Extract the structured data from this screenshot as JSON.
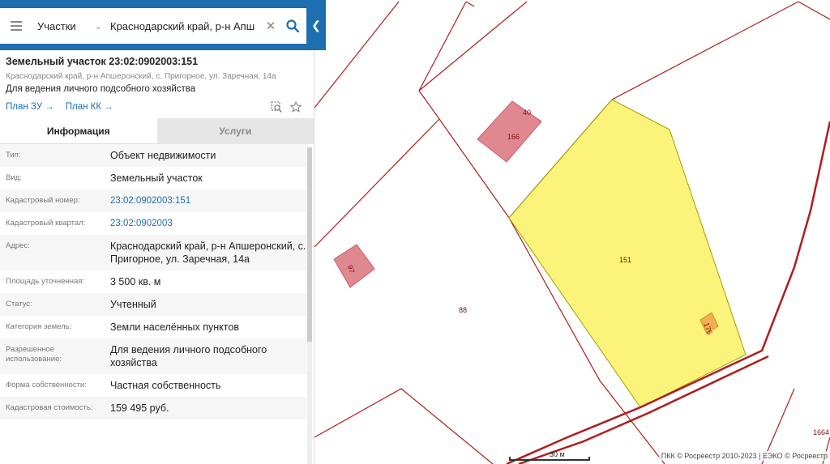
{
  "search": {
    "layer": "Участки",
    "query": "Краснодарский край, р-н Апш"
  },
  "parcel": {
    "title": "Земельный участок 23:02:0902003:151",
    "address_short": "Краснодарский край, р-н Апшеронский, с. Пригорное, ул. Заречная, 14а",
    "purpose": "Для ведения личного подсобного хозяйства",
    "links": [
      "План ЗУ →",
      "План КК →"
    ]
  },
  "tabs": [
    "Информация",
    "Услуги"
  ],
  "info_rows": [
    {
      "label": "Тип:",
      "value": "Объект недвижимости",
      "link": false
    },
    {
      "label": "Вид:",
      "value": "Земельный участок",
      "link": false
    },
    {
      "label": "Кадастровый номер:",
      "value": "23:02:0902003:151",
      "link": true
    },
    {
      "label": "Кадастровый квартал:",
      "value": "23:02:0902003",
      "link": true
    },
    {
      "label": "Адрес:",
      "value": "Краснодарский край, р-н Апшеронский, с. Пригорное, ул. Заречная, 14а",
      "link": false
    },
    {
      "label": "Площадь уточненная:",
      "value": "3 500 кв. м",
      "link": false
    },
    {
      "label": "Статус:",
      "value": "Учтенный",
      "link": false
    },
    {
      "label": "Категория земель:",
      "value": "Земли населённых пунктов",
      "link": false
    },
    {
      "label": "Разрешенное использование:",
      "value": "Для ведения личного подсобного хозяйства",
      "link": false
    },
    {
      "label": "Форма собственности:",
      "value": "Частная собственность",
      "link": false
    },
    {
      "label": "Кадастровая стоимость:",
      "value": "159 495 руб.",
      "link": false
    }
  ],
  "map": {
    "labels": {
      "p40": "40",
      "p166": "166",
      "p151": "151",
      "p88": "88",
      "p176": "176",
      "p97": "97",
      "p1664": "1664"
    },
    "scale": "30 м",
    "attribution": "ПКК © Росреестр 2010-2023 | ЕЭКО © Росреестр",
    "colors": {
      "boundary": "#b01c1c",
      "selected_fill": "#fcf37a",
      "building_fill": "#e08890"
    }
  }
}
